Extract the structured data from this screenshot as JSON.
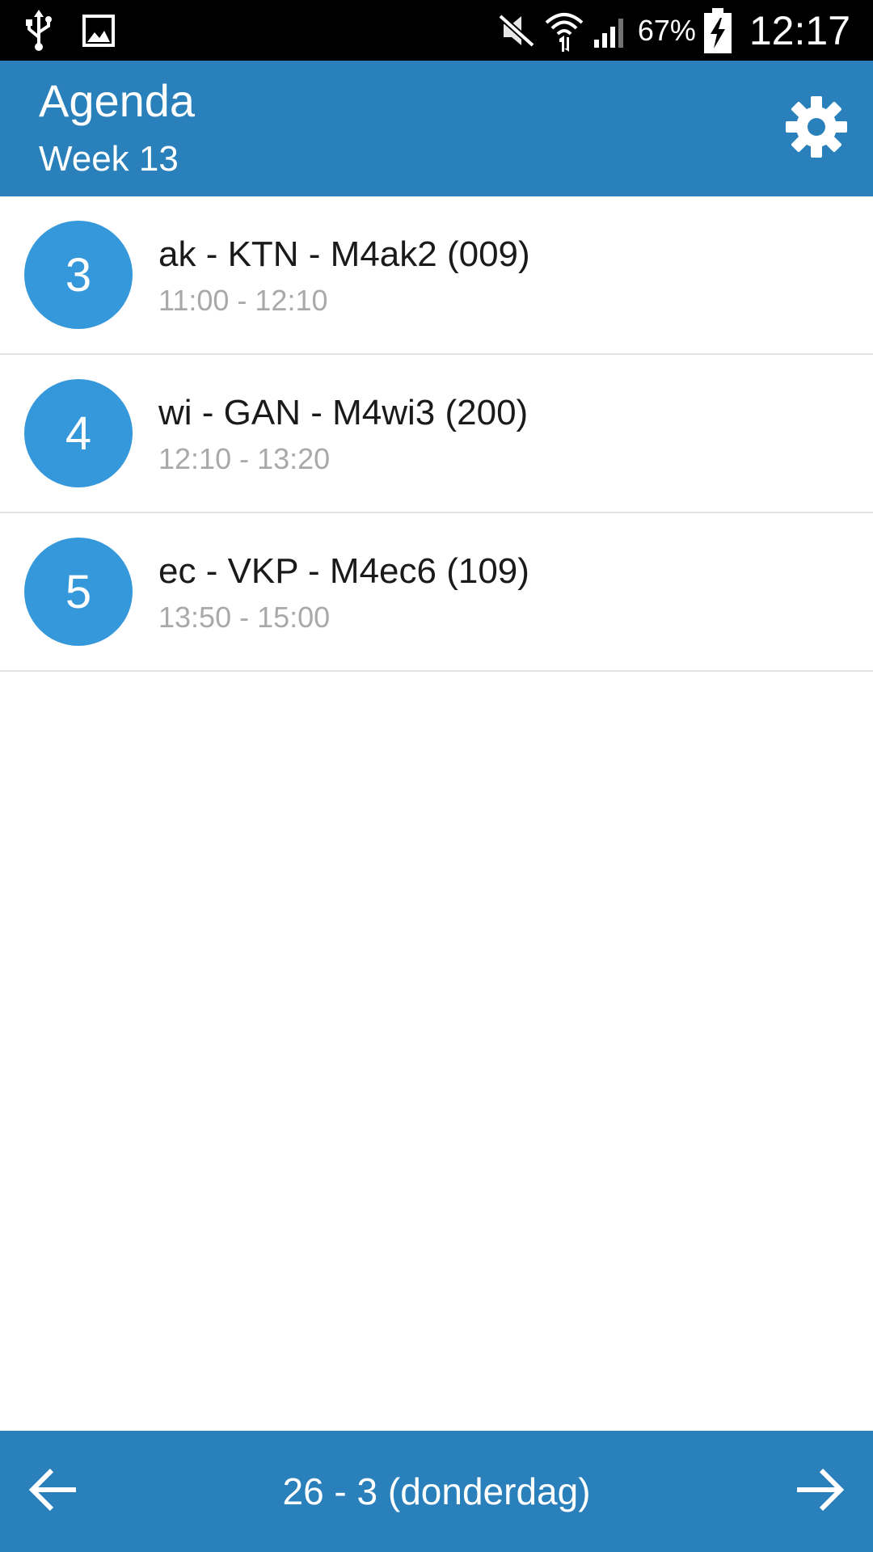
{
  "status_bar": {
    "icons_left": [
      "usb-icon",
      "image-icon"
    ],
    "icons_right": [
      "mute-icon",
      "wifi-icon",
      "signal-icon",
      "battery-charging-icon"
    ],
    "battery_percent": "67%",
    "time": "12:17"
  },
  "app_bar": {
    "title": "Agenda",
    "subtitle": "Week 13",
    "settings_icon": "gear-icon"
  },
  "lessons": [
    {
      "period": "3",
      "title": "ak - KTN - M4ak2 (009)",
      "time": "11:00 - 12:10"
    },
    {
      "period": "4",
      "title": "wi - GAN - M4wi3 (200)",
      "time": "12:10 - 13:20"
    },
    {
      "period": "5",
      "title": "ec - VKP - M4ec6 (109)",
      "time": "13:50 - 15:00"
    }
  ],
  "bottom_bar": {
    "date_label": "26 - 3 (donderdag)",
    "prev_icon": "arrow-left-icon",
    "next_icon": "arrow-right-icon"
  },
  "colors": {
    "primary": "#2a80bb",
    "accent_circle": "#3598db",
    "secondary_text": "#a9a9a9",
    "divider": "#e2e2e2"
  }
}
